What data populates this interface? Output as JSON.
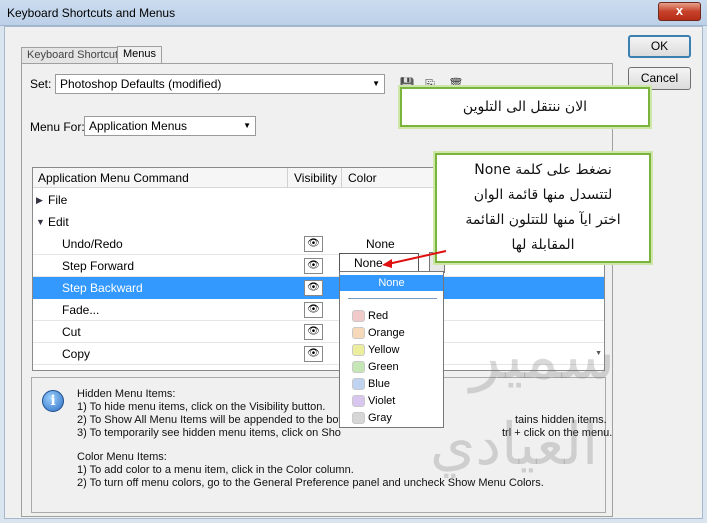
{
  "window": {
    "title": "Keyboard Shortcuts and Menus",
    "close_glyph": "x"
  },
  "tabs": [
    {
      "label": "Keyboard Shortcuts",
      "active": false
    },
    {
      "label": "Menus",
      "active": true
    }
  ],
  "set": {
    "label": "Set:",
    "value": "Photoshop Defaults (modified)"
  },
  "menu_for": {
    "label": "Menu For:",
    "value": "Application Menus"
  },
  "toolbar_icons": [
    "save-icon",
    "save-as-icon",
    "delete-icon"
  ],
  "columns": {
    "command": "Application Menu Command",
    "visibility": "Visibility",
    "color": "Color"
  },
  "rows": [
    {
      "name": "File",
      "type": "group",
      "expanded": false
    },
    {
      "name": "Edit",
      "type": "group",
      "expanded": true
    },
    {
      "name": "Undo/Redo",
      "type": "item",
      "color": "None"
    },
    {
      "name": "Step Forward",
      "type": "item",
      "color": "None"
    },
    {
      "name": "Step Backward",
      "type": "item",
      "color": "None",
      "selected": true
    },
    {
      "name": "Fade...",
      "type": "item"
    },
    {
      "name": "Cut",
      "type": "item"
    },
    {
      "name": "Copy",
      "type": "item"
    }
  ],
  "color_dropdown": {
    "current": "None",
    "options": [
      {
        "label": "None",
        "selected": true
      },
      {
        "label": "Red",
        "swatch": "#f2c9c9"
      },
      {
        "label": "Orange",
        "swatch": "#f6d9b8"
      },
      {
        "label": "Yellow",
        "swatch": "#eded9e"
      },
      {
        "label": "Green",
        "swatch": "#c5e6b5"
      },
      {
        "label": "Blue",
        "swatch": "#bdd3ef"
      },
      {
        "label": "Violet",
        "swatch": "#d9c6ee"
      },
      {
        "label": "Gray",
        "swatch": "#d6d6d6"
      }
    ]
  },
  "info": {
    "hidden_title": "Hidden Menu Items:",
    "hidden_1": "1) To hide menu items, click on the Visibility button.",
    "hidden_2": "2) To Show All Menu Items will be appended to the botto",
    "hidden_2b": "tains hidden items.",
    "hidden_3": "3) To temporarily see hidden menu items, click on Sho",
    "hidden_3b": "trl + click on the menu.",
    "color_title": "Color Menu Items:",
    "color_1": "1) To add color to a menu item, click in the Color column.",
    "color_2": "2) To turn off menu colors, go to the General Preference panel and uncheck Show Menu Colors."
  },
  "buttons": {
    "ok": "OK",
    "cancel": "Cancel"
  },
  "notes": {
    "top": "الان ننتقل الى التلوين",
    "side_1": "نضغط على كلمة None",
    "side_2": "لتتسدل منها قائمة الوان",
    "side_3": "اختر ايآ منها للتتلون القائمة",
    "side_4": "المقابلة لها"
  },
  "watermark": {
    "line1": "سمير",
    "line2": "العيادي"
  }
}
